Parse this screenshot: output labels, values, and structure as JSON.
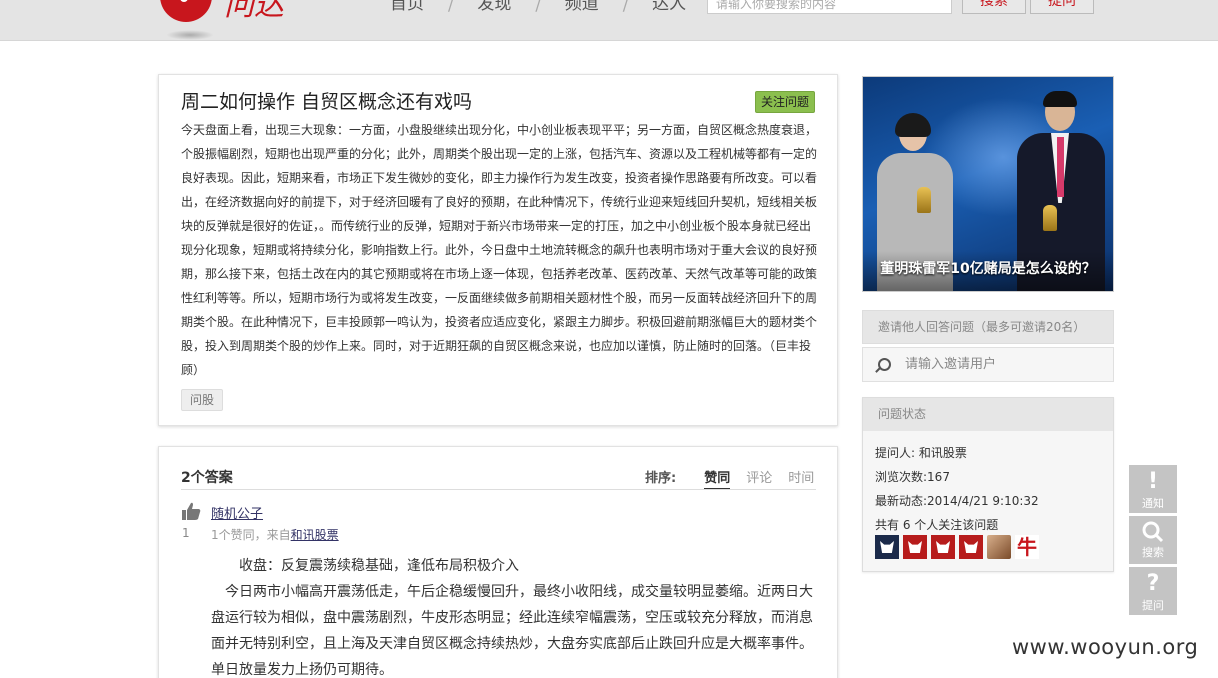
{
  "header": {
    "logo_text": "问达",
    "nav": [
      "首页",
      "发现",
      "频道",
      "达人"
    ],
    "search_placeholder": "请输入你要搜索的内容",
    "search_button": "搜索",
    "ask_button": "提问"
  },
  "question": {
    "title": "周二如何操作  自贸区概念还有戏吗",
    "follow_button": "关注问题",
    "body": "今天盘面上看，出现三大现象：一方面，小盘股继续出现分化，中小创业板表现平平；另一方面，自贸区概念热度衰退，个股振幅剧烈，短期也出现严重的分化；此外，周期类个股出现一定的上涨，包括汽车、资源以及工程机械等都有一定的良好表现。因此，短期来看，市场正下发生微妙的变化，即主力操作行为发生改变，投资者操作思路要有所改变。可以看出，在经济数据向好的前提下，对于经济回暖有了良好的预期，在此种情况下，传统行业迎来短线回升契机，短线相关板块的反弹就是很好的佐证，。而传统行业的反弹，短期对于新兴市场带来一定的打压，加之中小创业板个股本身就已经出现分化现象，短期或将持续分化，影响指数上行。此外，今日盘中土地流转概念的飙升也表明市场对于重大会议的良好预期，那么接下来，包括土改在内的其它预期或将在市场上逐一体现，包括养老改革、医药改革、天然气改革等可能的政策性红利等等。所以，短期市场行为或将发生改变，一反面继续做多前期相关题材性个股，而另一反面转战经济回升下的周期类个股。在此种情况下，巨丰投顾郭一鸣认为，投资者应适应变化，紧跟主力脚步。积极回避前期涨幅巨大的题材类个股，投入到周期类个股的炒作上来。同时，对于近期狂飙的自贸区概念来说，也应加以谨慎，防止随时的回落。（巨丰投顾）",
    "tag": "问股"
  },
  "answers": {
    "count_label": "2个答案",
    "sort_label": "排序:",
    "sort_options": [
      "赞同",
      "评论",
      "时间"
    ],
    "item": {
      "vote_count": "1",
      "user": "随机公子",
      "meta_prefix": "1个赞同，来自",
      "meta_source": "和讯股票",
      "lead": "收盘：反复震荡续稳基础，逢低布局积极介入",
      "paragraph": "今日两市小幅高开震荡低走，午后企稳缓慢回升，最终小收阳线，成交量较明显萎缩。近两日大盘运行较为相似，盘中震荡剧烈，牛皮形态明显；经此连续窄幅震荡，空压或较充分释放，而消息面并无特别利空，且上海及天津自贸区概念持续热炒，大盘夯实底部后止跌回升应是大概率事件。单日放量发力上扬仍可期待。"
    }
  },
  "banner": {
    "caption": "董明珠雷军10亿赌局是怎么设的？"
  },
  "invite": {
    "heading": "邀请他人回答问题（最多可邀请20名）",
    "placeholder": "请输入邀请用户"
  },
  "status": {
    "heading": "问题状态",
    "asker": "提问人: 和讯股票",
    "views": "浏览次数:167",
    "latest": "最新动态:2014/4/21 9:10:32",
    "followers": "共有 6 个人关注该问题",
    "avatar_glyph": "牛"
  },
  "side": {
    "notify": "通知",
    "search": "搜索",
    "ask": "提问",
    "notify_glyph": "!",
    "ask_glyph": "?"
  },
  "watermark": "www.wooyun.org",
  "colors": {
    "brand": "#c8161d",
    "follow_green": "#8bbf4e",
    "header_bg": "#e4e4e4"
  }
}
